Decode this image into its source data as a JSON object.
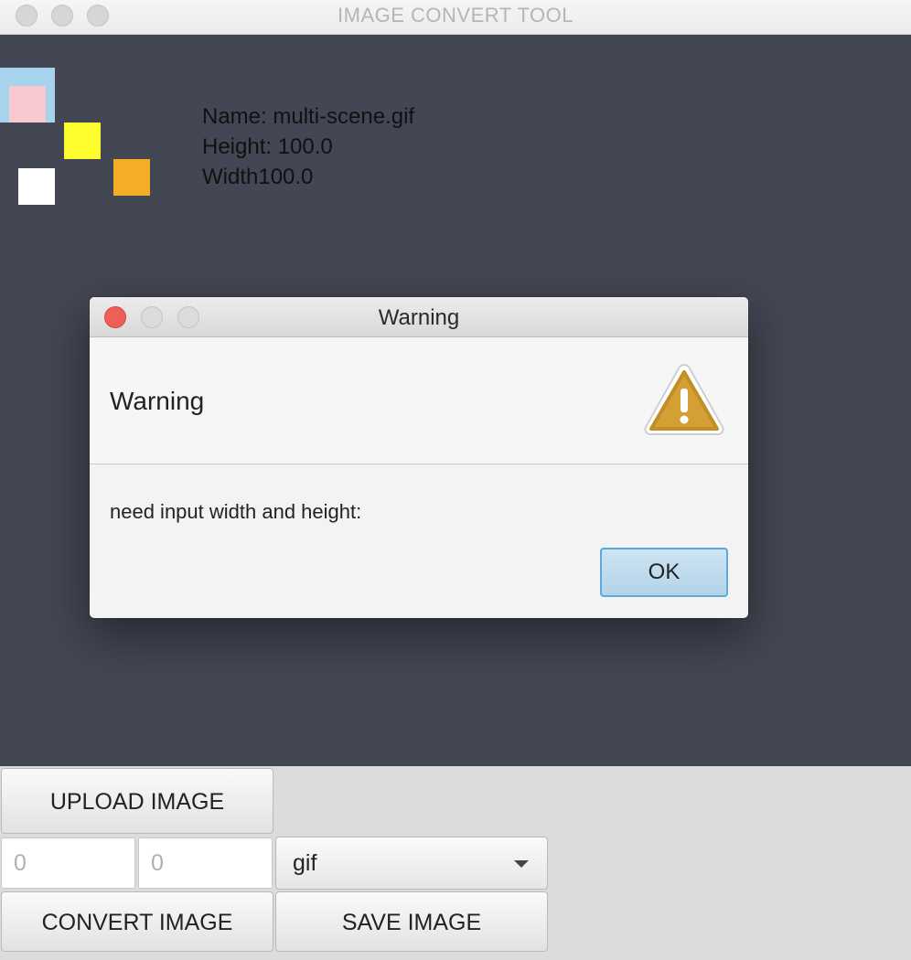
{
  "window": {
    "title": "IMAGE CONVERT TOOL"
  },
  "image_info": {
    "name_line": "Name: multi-scene.gif",
    "height_line": "Height: 100.0",
    "width_line": "Width100.0"
  },
  "preview_colors": {
    "light_blue": "#a8d3ec",
    "pink": "#f7c8d0",
    "yellow": "#fdfd2e",
    "white": "#ffffff",
    "orange": "#f5ad27"
  },
  "dialog": {
    "title": "Warning",
    "header": "Warning",
    "header_icon": "warning-triangle-icon",
    "message": "need input width and height:",
    "ok_label": "OK"
  },
  "controls": {
    "upload_label": "UPLOAD IMAGE",
    "width_value": "0",
    "height_value": "0",
    "format_value": "gif",
    "convert_label": "CONVERT IMAGE",
    "save_label": "SAVE IMAGE"
  }
}
